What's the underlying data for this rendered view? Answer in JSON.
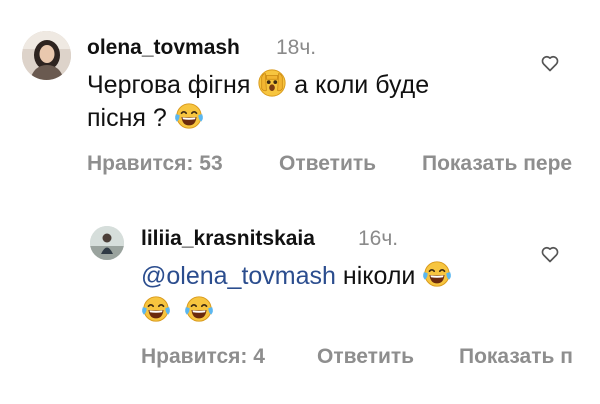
{
  "comment": {
    "username": "olena_tovmash",
    "time": "18ч.",
    "line1_text": "Чергова фігня",
    "line1_text_after": "а коли буде",
    "line2_text": "пісня ?",
    "emoji_1": "face-with-peeking-eye",
    "emoji_2": "face-with-tears-of-joy",
    "likes_label": "Нравится: 53",
    "reply_label": "Ответить",
    "translate_label": "Показать пере"
  },
  "reply": {
    "username": "liliia_krasnitskaia",
    "time": "16ч.",
    "mention": "@olena_tovmash",
    "text": " ніколи",
    "emoji": "face-with-tears-of-joy",
    "likes_label": "Нравится: 4",
    "reply_label": "Ответить",
    "translate_label": "Показать п"
  },
  "colors": {
    "mention": "#2b4d8e",
    "muted": "#8e8e8e",
    "text": "#111111"
  }
}
